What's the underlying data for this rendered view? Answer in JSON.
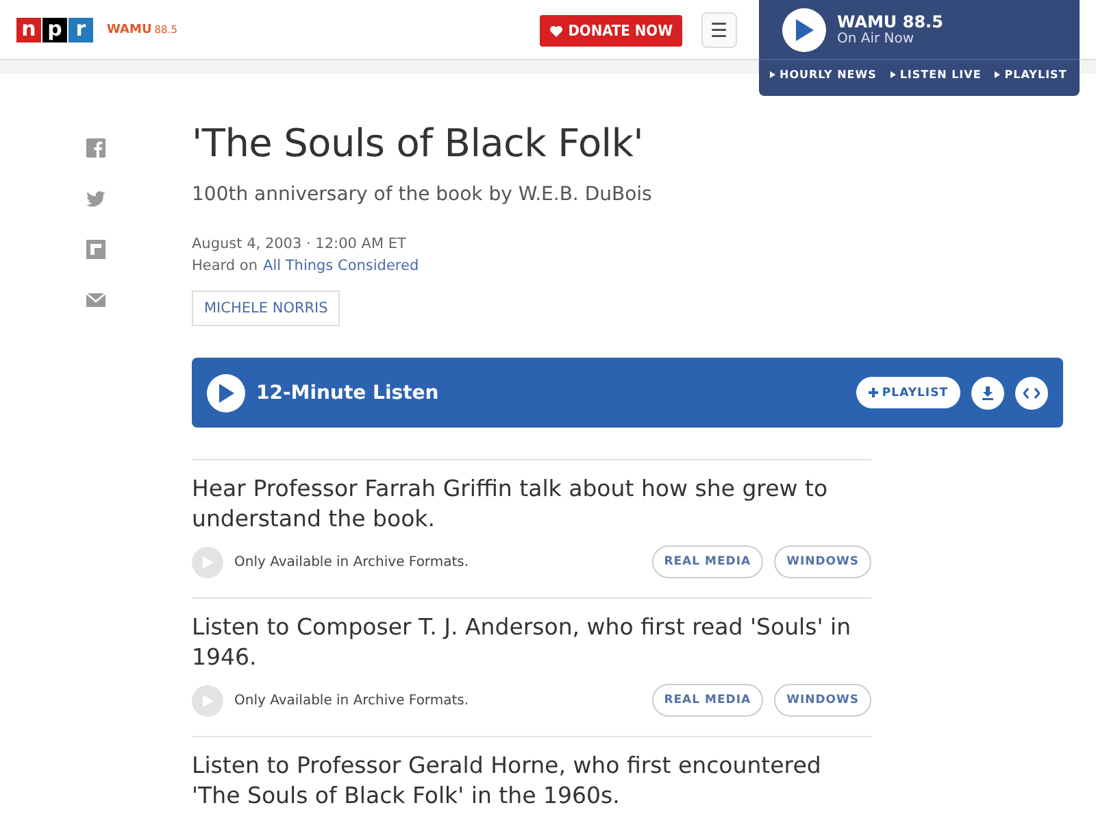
{
  "header": {
    "logo_letters": [
      "n",
      "p",
      "r"
    ],
    "station": "WAMU",
    "station_freq": "88.5",
    "donate": "DONATE NOW",
    "menu_icon": "☰"
  },
  "player": {
    "station": "WAMU 88.5",
    "status": "On Air Now",
    "links": [
      "HOURLY NEWS",
      "LISTEN LIVE",
      "PLAYLIST"
    ]
  },
  "share": [
    {
      "kind": "facebook"
    },
    {
      "kind": "twitter"
    },
    {
      "kind": "flipboard"
    },
    {
      "kind": "email"
    }
  ],
  "story": {
    "title": "'The Souls of Black Folk'",
    "subtitle": "100th anniversary of the book by W.E.B. DuBois",
    "date": "August 4, 2003 · 12:00 AM ET",
    "heard_on": "Heard on",
    "program": "All Things Considered",
    "byline": "MICHELE NORRIS"
  },
  "listen": {
    "label": "12-Minute Listen",
    "playlist": "PLAYLIST"
  },
  "segments": [
    {
      "title": "Hear Professor Farrah Griffin talk about how she grew to understand the book.",
      "note": "Only Available in Archive Formats.",
      "formats": [
        "REAL MEDIA",
        "WINDOWS"
      ]
    },
    {
      "title": "Listen to Composer T. J. Anderson, who first read 'Souls' in 1946.",
      "note": "Only Available in Archive Formats.",
      "formats": [
        "REAL MEDIA",
        "WINDOWS"
      ]
    },
    {
      "title": "Listen to Professor Gerald Horne, who first encountered 'The Souls of Black Folk' in the 1960s."
    }
  ]
}
